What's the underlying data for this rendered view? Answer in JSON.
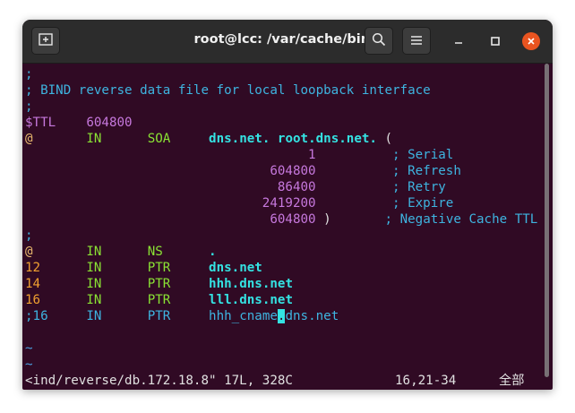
{
  "window": {
    "title": "root@lcc: /var/cache/bind",
    "icons": {
      "new_tab": "new-tab-icon",
      "search": "search-icon",
      "menu": "hamburger-menu-icon",
      "minimize": "minimize-icon",
      "maximize": "maximize-icon",
      "close": "close-icon"
    }
  },
  "editor": {
    "comment1": ";",
    "comment2": "; BIND reverse data file for local loopback interface",
    "comment3": ";",
    "ttl_key": "$TTL",
    "ttl_val": "604800",
    "soa_at": "@",
    "soa_in": "IN",
    "soa_type": "SOA",
    "soa_ns": "dns.net.",
    "soa_mail": "root.dns.net.",
    "soa_paren": "(",
    "serial_val": "1",
    "serial_cmt": "; Serial",
    "refresh_val": "604800",
    "refresh_cmt": "; Refresh",
    "retry_val": "86400",
    "retry_cmt": "; Retry",
    "expire_val": "2419200",
    "expire_cmt": "; Expire",
    "negttl_val": "604800",
    "negttl_paren": ")",
    "negttl_cmt": "; Negative Cache TTL",
    "comment4": ";",
    "ns_at": "@",
    "ns_in": "IN",
    "ns_type": "NS",
    "ns_val": ".",
    "r1_num": "12",
    "r1_in": "IN",
    "r1_type": "PTR",
    "r1_val": "dns.net",
    "r2_num": "14",
    "r2_in": "IN",
    "r2_type": "PTR",
    "r2_val": "hhh.dns.net",
    "r3_num": "16",
    "r3_in": "IN",
    "r3_type": "PTR",
    "r3_val": "lll.dns.net",
    "r4_num": ";16",
    "r4_in": "IN",
    "r4_type": "PTR",
    "r4_val_a": "hhh_cname",
    "r4_cursor": ".",
    "r4_val_b": "dns.net",
    "tilde1": "~",
    "tilde2": "~"
  },
  "statusline": {
    "file": "<ind/reverse/db.172.18.8\" 17L, 328C",
    "position": "16,21-34",
    "scroll": "全部"
  }
}
